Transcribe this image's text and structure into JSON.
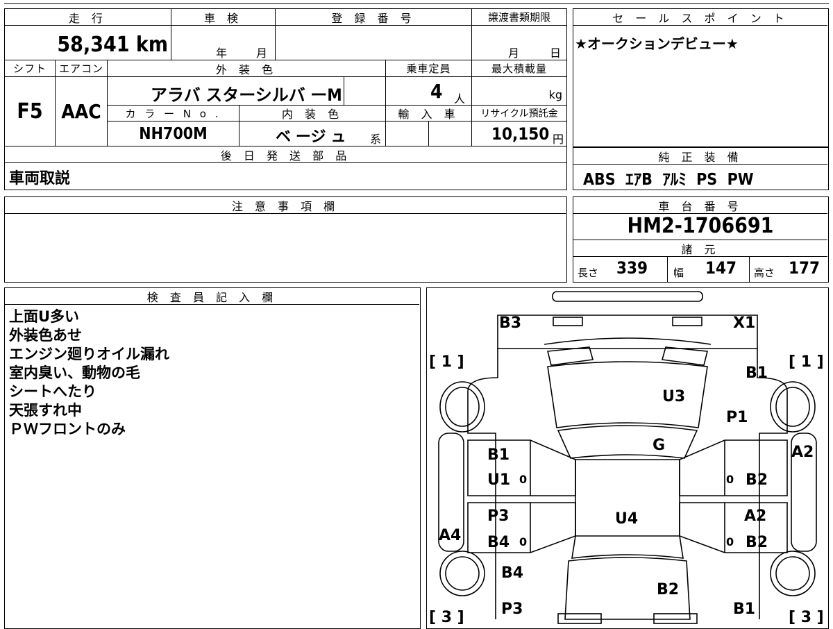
{
  "sheet": {
    "mileage_label": "走 行",
    "mileage_value": "58,341 km",
    "inspection_label": "車 検",
    "inspection_year_unit": "年",
    "inspection_month_unit": "月",
    "registration_label": "登 録 番 号",
    "transfer_label": "譲渡書類期限",
    "transfer_month_unit": "月",
    "transfer_day_unit": "日",
    "shift_label": "シフト",
    "shift_value": "F5",
    "aircon_label": "エアコン",
    "aircon_value": "AAC",
    "ext_color_label": "外 装 色",
    "ext_color_value": "アラバ スターシルバ ーM",
    "capacity_label": "乗車定員",
    "capacity_value": "4",
    "capacity_unit": "人",
    "max_load_label": "最大積載量",
    "max_load_unit": "kg",
    "color_no_label": "カ ラ ー N o .",
    "color_no_value": "NH700M",
    "int_color_label": "内 装 色",
    "int_color_value": "ベ ージ ュ",
    "int_color_suffix": "系",
    "import_label": "輸 入 車",
    "recycle_label": "リサイクル預託金",
    "recycle_value": "10,150",
    "recycle_unit": "円",
    "later_parts_label": "後 日 発 送 部 品",
    "later_parts_value": "車両取説",
    "sales_point_label": "セ ー ル ス ポ イ ン ト",
    "sales_point_value": "★オークションデビュー★",
    "equipment_label": "純 正 装 備",
    "equipment_value": "ABS  ｴｱB  ｱﾙﾐ  PS  PW",
    "caution_label": "注 意 事 項 欄",
    "chassis_label": "車 台 番 号",
    "chassis_value": "HM2-1706691",
    "specs_label": "諸 元",
    "length_label": "長さ",
    "length_value": "339",
    "width_label": "幅",
    "width_value": "147",
    "height_label": "高さ",
    "height_value": "177",
    "inspector_label": "検 査 員 記 入 欄",
    "inspector_notes": [
      "上面U多い",
      "外装色あせ",
      "エンジン廻りオイル漏れ",
      "室内臭い、動物の毛",
      "シートへたり",
      "天張すれ中",
      "ＰＷフロントのみ"
    ]
  },
  "diagram": {
    "marks": {
      "B3_top": "B3",
      "X1": "X1",
      "bracket_1_left": "[ 1 ]",
      "bracket_1_right": "[ 1 ]",
      "B1_right_front": "B1",
      "U3": "U3",
      "P1": "P1",
      "G": "G",
      "A2_right": "A2",
      "B1_left_door": "B1",
      "U1": "U1",
      "zero_1": "0",
      "zero_2": "0",
      "B2_right_door": "B2",
      "U4": "U4",
      "P3_left": "P3",
      "A2_right_rear": "A2",
      "A4": "A4",
      "B4_left": "B4",
      "zero_3": "0",
      "zero_4": "0",
      "B2_right_rear": "B2",
      "B4_rear": "B4",
      "B2_bottom": "B2",
      "P3_bottom": "P3",
      "B1_bottom": "B1",
      "bracket_3_left": "[ 3 ]",
      "bracket_3_right": "[ 3 ]"
    }
  }
}
